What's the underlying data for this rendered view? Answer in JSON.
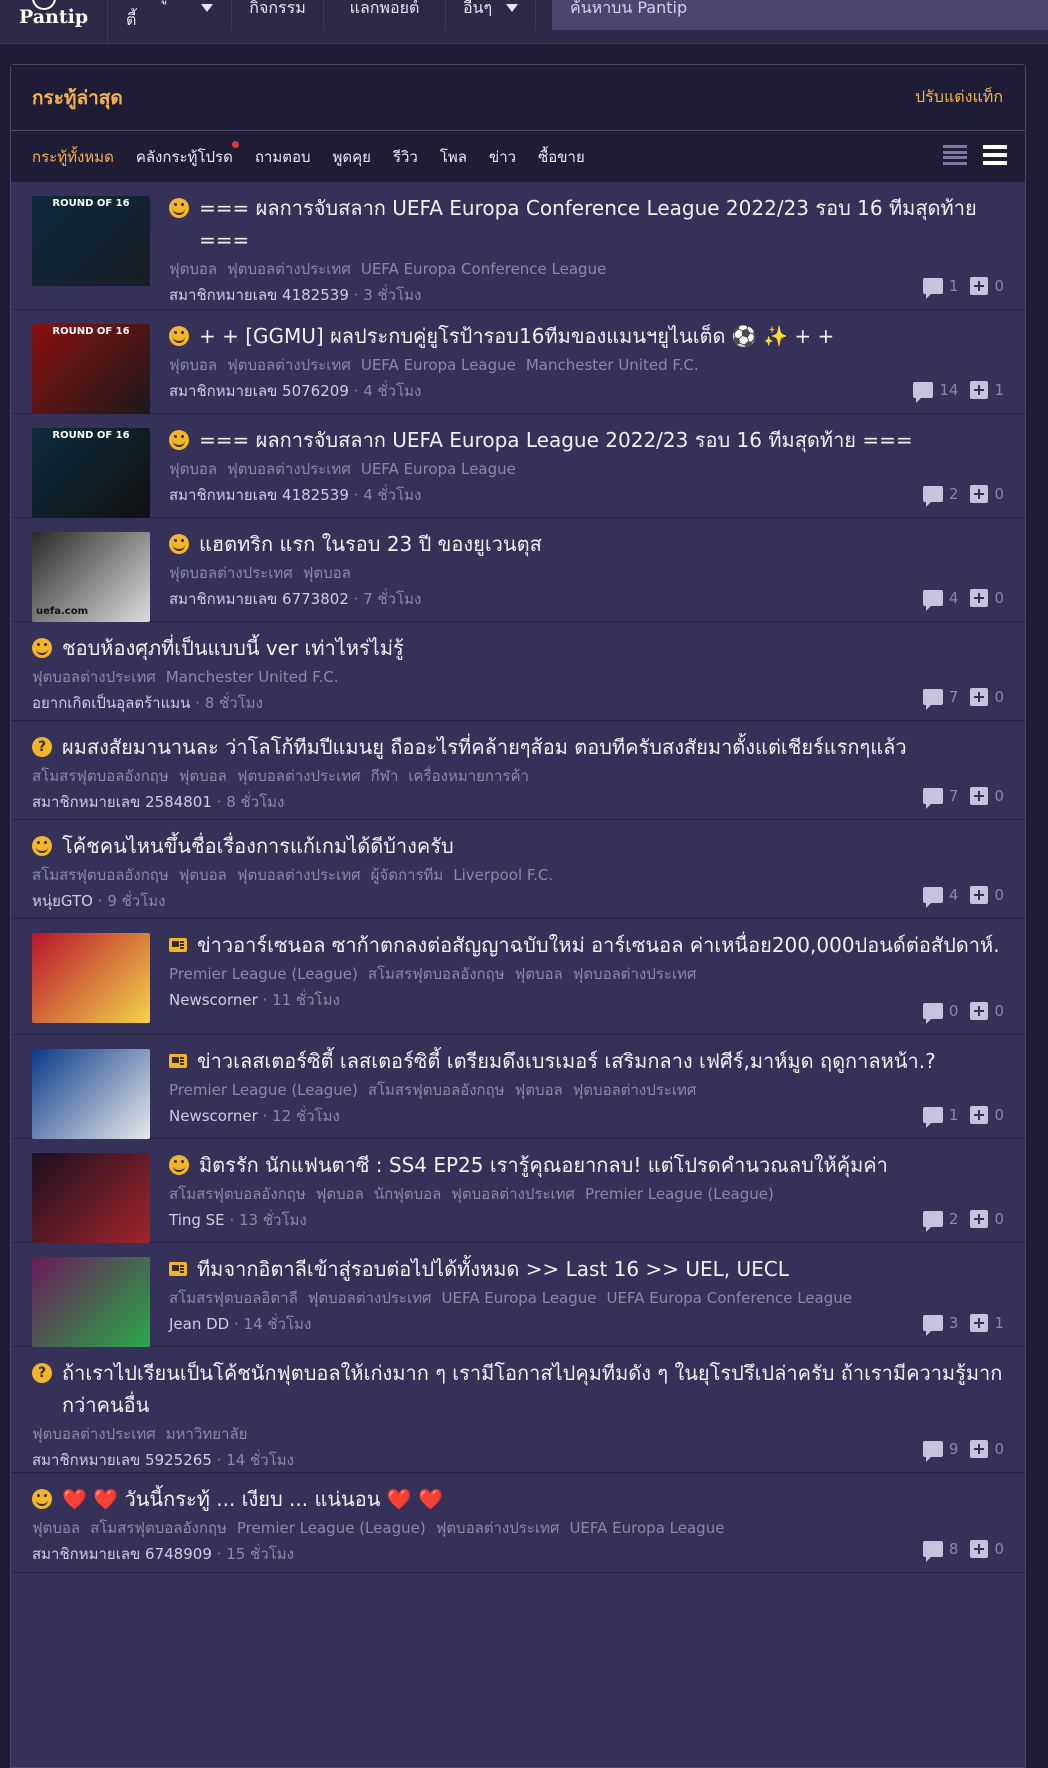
{
  "nav": {
    "logo": "Pantip",
    "items": [
      "คอมมูนิตี้",
      "กิจกรรม",
      "แลกพอยต์",
      "อื่นๆ"
    ],
    "search_placeholder": "ค้นหาบน Pantip"
  },
  "panel": {
    "title": "กระทู้ล่าสุด",
    "customize_link": "ปรับแต่งแท็ก",
    "tabs": [
      "กระทู้ทั้งหมด",
      "คลังกระทู้โปรด",
      "ถามตอบ",
      "พูดคุย",
      "รีวิว",
      "โพล",
      "ข่าว",
      "ซื้อขาย"
    ]
  },
  "colors": {
    "accent": "#f6b24a",
    "panel": "#353158",
    "header": "#1f1d35"
  },
  "topics": [
    {
      "icon": "smile",
      "title": "=== ผลการจับสลาก UEFA Europa Conference League 2022/23 รอบ 16 ทีมสุดท้าย ===",
      "tags": [
        "ฟุตบอล",
        "ฟุตบอลต่างประเทศ",
        "UEFA Europa Conference League"
      ],
      "author": "สมาชิกหมายเลข 4182539",
      "time": "3 ชั่วโมง",
      "comments": "1",
      "votes": "0",
      "thumb_label": "ROUND OF 16"
    },
    {
      "icon": "smile",
      "title": "+ + [GGMU] ผลประกบคู่ยูโรป้ารอบ16ทีมของแมนฯยูไนเต็ด ⚽ ✨ + +",
      "tags": [
        "ฟุตบอล",
        "ฟุตบอลต่างประเทศ",
        "UEFA Europa League",
        "Manchester United F.C."
      ],
      "author": "สมาชิกหมายเลข 5076209",
      "time": "4 ชั่วโมง",
      "comments": "14",
      "votes": "1",
      "thumb_label": "ROUND OF 16"
    },
    {
      "icon": "smile",
      "title": "=== ผลการจับสลาก UEFA Europa League 2022/23 รอบ 16 ทีมสุดท้าย ===",
      "tags": [
        "ฟุตบอล",
        "ฟุตบอลต่างประเทศ",
        "UEFA Europa League"
      ],
      "author": "สมาชิกหมายเลข 4182539",
      "time": "4 ชั่วโมง",
      "comments": "2",
      "votes": "0",
      "thumb_label": "ROUND OF 16"
    },
    {
      "icon": "smile",
      "title": "แฮตทริก แรก ในรอบ 23 ปี ของยูเวนตุส",
      "tags": [
        "ฟุตบอลต่างประเทศ",
        "ฟุตบอล"
      ],
      "author": "สมาชิกหมายเลข 6773802",
      "time": "7 ชั่วโมง",
      "comments": "4",
      "votes": "0",
      "thumb_label": "uefa.com"
    },
    {
      "icon": "smile",
      "title": "ชอบห้องศุภที่เป็นแบบนี้ ver เท่าไหร่ไม่รู้",
      "tags": [
        "ฟุตบอลต่างประเทศ",
        "Manchester United F.C."
      ],
      "author": "อยากเกิดเป็นอุลตร้าแมน",
      "time": "8 ชั่วโมง",
      "comments": "7",
      "votes": "0"
    },
    {
      "icon": "question",
      "title": "ผมสงสัยมานานละ ว่าโลโก้ทีมปีแมนยู ถืออะไรที่คล้ายๆส้อม ตอบทีครับสงสัยมาตั้งแต่เชียร์แรกๆแล้ว",
      "tags": [
        "สโมสรฟุตบอลอังกฤษ",
        "ฟุตบอล",
        "ฟุตบอลต่างประเทศ",
        "กีฬา",
        "เครื่องหมายการค้า"
      ],
      "author": "สมาชิกหมายเลข 2584801",
      "time": "8 ชั่วโมง",
      "comments": "7",
      "votes": "0"
    },
    {
      "icon": "smile",
      "title": "โค้ชคนไหนขึ้นชื่อเรื่องการแก้เกมได้ดีบ้างครับ",
      "tags": [
        "สโมสรฟุตบอลอังกฤษ",
        "ฟุตบอล",
        "ฟุตบอลต่างประเทศ",
        "ผู้จัดการทีม",
        "Liverpool F.C."
      ],
      "author": "หนุ่ยGTO",
      "time": "9 ชั่วโมง",
      "comments": "4",
      "votes": "0"
    },
    {
      "icon": "news",
      "title": "ข่าวอาร์เซนอล ซาก้าตกลงต่อสัญญาฉบับใหม่ อาร์เซนอล ค่าเหนื่อย200,000ปอนด์ต่อสัปดาห์.",
      "tags": [
        "Premier League (League)",
        "สโมสรฟุตบอลอังกฤษ",
        "ฟุตบอล",
        "ฟุตบอลต่างประเทศ"
      ],
      "author": "Newscorner",
      "time": "11 ชั่วโมง",
      "comments": "0",
      "votes": "0"
    },
    {
      "icon": "news",
      "title": "ข่าวเลสเตอร์ซิตี้ เลสเตอร์ซิตี้ เตรียมดึงเบรเมอร์ เสริมกลาง เฟศีร์,มาห์มูด ฤดูกาลหน้า.?",
      "tags": [
        "Premier League (League)",
        "สโมสรฟุตบอลอังกฤษ",
        "ฟุตบอล",
        "ฟุตบอลต่างประเทศ"
      ],
      "author": "Newscorner",
      "time": "12 ชั่วโมง",
      "comments": "1",
      "votes": "0"
    },
    {
      "icon": "smile",
      "title": "มิตรรัก นักแฟนตาซี : SS4 EP25 เรารู้คุณอยากลบ! แต่โปรดคำนวณลบให้คุ้มค่า",
      "tags": [
        "สโมสรฟุตบอลอังกฤษ",
        "ฟุตบอล",
        "นักฟุตบอล",
        "ฟุตบอลต่างประเทศ",
        "Premier League (League)"
      ],
      "author": "Ting SE",
      "time": "13 ชั่วโมง",
      "comments": "2",
      "votes": "0"
    },
    {
      "icon": "news",
      "title": "ทีมจากอิตาลีเข้าสู่รอบต่อไปได้ทั้งหมด >> Last 16 >> UEL, UECL",
      "tags": [
        "สโมสรฟุตบอลอิตาลี",
        "ฟุตบอลต่างประเทศ",
        "UEFA Europa League",
        "UEFA Europa Conference League"
      ],
      "author": "Jean DD",
      "time": "14 ชั่วโมง",
      "comments": "3",
      "votes": "1"
    },
    {
      "icon": "question",
      "title": "ถ้าเราไปเรียนเป็นโค้ชนักฟุตบอลให้เก่งมาก ๆ เรามีโอกาสไปคุมทีมดัง ๆ ในยุโรปรึเปล่าครับ ถ้าเรามีความรู้มากกว่าคนอื่น",
      "tags": [
        "ฟุตบอลต่างประเทศ",
        "มหาวิทยาลัย"
      ],
      "author": "สมาชิกหมายเลข 5925265",
      "time": "14 ชั่วโมง",
      "comments": "9",
      "votes": "0"
    },
    {
      "icon": "smile",
      "title": "❤️ ❤️ วันนี้กระทู้ ... เงียบ ... แน่นอน ❤️ ❤️",
      "tags": [
        "ฟุตบอล",
        "สโมสรฟุตบอลอังกฤษ",
        "Premier League (League)",
        "ฟุตบอลต่างประเทศ",
        "UEFA Europa League"
      ],
      "author": "สมาชิกหมายเลข 6748909",
      "time": "15 ชั่วโมง",
      "comments": "8",
      "votes": "0"
    }
  ]
}
